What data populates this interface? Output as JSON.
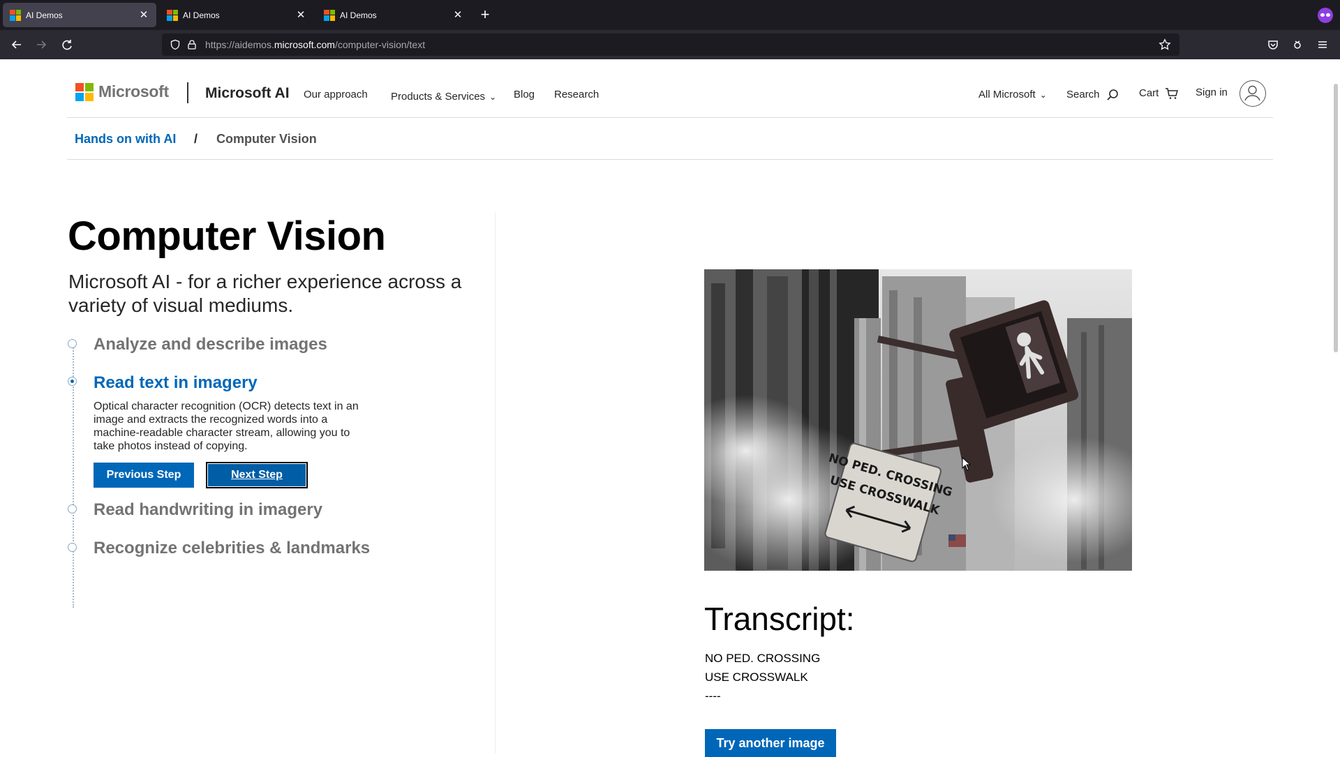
{
  "browser": {
    "tabs": [
      {
        "title": "AI Demos",
        "active": true
      },
      {
        "title": "AI Demos",
        "active": false
      },
      {
        "title": "AI Demos",
        "active": false
      }
    ],
    "url_prefix": "https://aidemos.",
    "url_domain": "microsoft.com",
    "url_path": "/computer-vision/text"
  },
  "header": {
    "logo_text": "Microsoft",
    "brand": "Microsoft AI",
    "nav": [
      "Our approach",
      "Products & Services",
      "Blog",
      "Research"
    ],
    "all_microsoft": "All Microsoft",
    "search": "Search",
    "cart": "Cart",
    "sign_in": "Sign in"
  },
  "breadcrumb": {
    "parent": "Hands on with AI",
    "separator": "/",
    "current": "Computer Vision"
  },
  "main": {
    "title": "Computer Vision",
    "subtitle": "Microsoft AI - for a richer experience across a variety of visual mediums.",
    "steps": [
      {
        "title": "Analyze and describe images",
        "active": false
      },
      {
        "title": "Read text in imagery",
        "active": true,
        "description": "Optical character recognition (OCR) detects text in an image and extracts the recognized words into a machine-readable character stream, allowing you to take photos instead of copying."
      },
      {
        "title": "Read handwriting in imagery",
        "active": false
      },
      {
        "title": "Recognize celebrities & landmarks",
        "active": false
      }
    ],
    "prev_button": "Previous Step",
    "next_button": "Next Step"
  },
  "result": {
    "sign_line1": "NO PED. CROSSING",
    "sign_line2": "USE CROSSWALK",
    "transcript_heading": "Transcript:",
    "transcript_lines": [
      "NO PED. CROSSING",
      "USE CROSSWALK",
      "----"
    ],
    "try_button": "Try another image"
  },
  "colors": {
    "accent": "#0067b8",
    "ms_red": "#f25022",
    "ms_green": "#7fba00",
    "ms_blue": "#00a4ef",
    "ms_yellow": "#ffb900"
  }
}
